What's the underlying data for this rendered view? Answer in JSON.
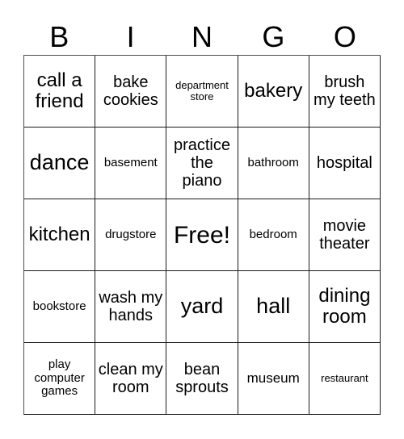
{
  "header": {
    "letters": [
      "B",
      "I",
      "N",
      "G",
      "O"
    ]
  },
  "grid": {
    "rows": 5,
    "columns": 5,
    "border_color": "#1a1a1a",
    "background_color": "#ffffff",
    "text_color": "#000000",
    "cells": [
      [
        {
          "text": "call a friend",
          "size": "xl"
        },
        {
          "text": "bake cookies",
          "size": "lg"
        },
        {
          "text": "department store",
          "size": "xs"
        },
        {
          "text": "bakery",
          "size": "xl"
        },
        {
          "text": "brush my teeth",
          "size": "lg"
        }
      ],
      [
        {
          "text": "dance",
          "size": "xxl"
        },
        {
          "text": "basement",
          "size": "sm"
        },
        {
          "text": "practice the piano",
          "size": "lg"
        },
        {
          "text": "bathroom",
          "size": "sm"
        },
        {
          "text": "hospital",
          "size": "lg"
        }
      ],
      [
        {
          "text": "kitchen",
          "size": "xl"
        },
        {
          "text": "drugstore",
          "size": "sm"
        },
        {
          "text": "Free!",
          "size": "free"
        },
        {
          "text": "bedroom",
          "size": "sm"
        },
        {
          "text": "movie theater",
          "size": "lg"
        }
      ],
      [
        {
          "text": "bookstore",
          "size": "sm"
        },
        {
          "text": "wash my hands",
          "size": "lg"
        },
        {
          "text": "yard",
          "size": "xxl"
        },
        {
          "text": "hall",
          "size": "xxl"
        },
        {
          "text": "dining room",
          "size": "xl"
        }
      ],
      [
        {
          "text": "play computer games",
          "size": "sm"
        },
        {
          "text": "clean my room",
          "size": "lg"
        },
        {
          "text": "bean sprouts",
          "size": "lg"
        },
        {
          "text": "museum",
          "size": "md"
        },
        {
          "text": "restaurant",
          "size": "xs"
        }
      ]
    ]
  }
}
